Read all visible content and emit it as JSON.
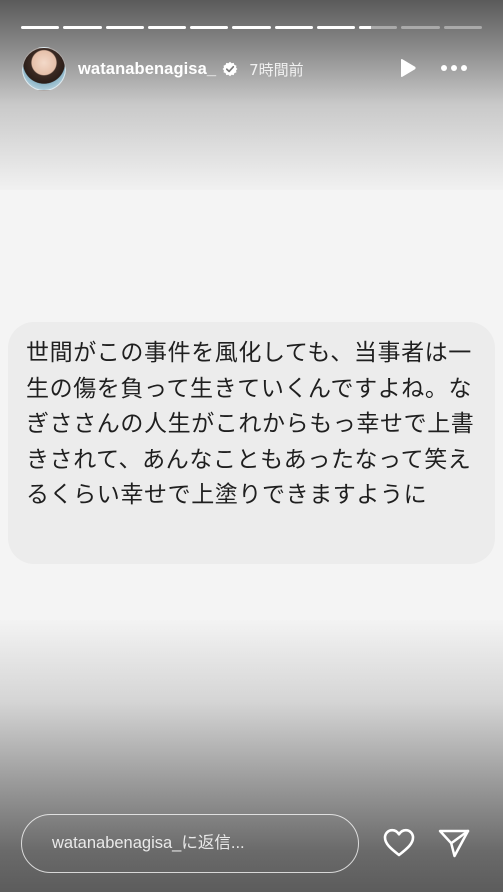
{
  "story": {
    "username": "watanabenagisa_",
    "posted_time": "7時間前",
    "progress": {
      "total_segments": 11,
      "completed_segments": 8,
      "current_segment_fraction": 0.3
    }
  },
  "message": {
    "text": "世間がこの事件を風化しても、当事者は一生の傷を負って生きていくんですよね。なぎささんの人生がこれからもっ幸せで上書きされて、あんなこともあったなって笑えるくらい幸せで上塗りできますように"
  },
  "reply": {
    "placeholder": "watanabenagisa_に返信..."
  },
  "icons": {
    "verified": "verified-badge-icon",
    "play": "play-icon",
    "more": "more-horizontal-icon",
    "like": "heart-icon",
    "share": "send-icon"
  }
}
